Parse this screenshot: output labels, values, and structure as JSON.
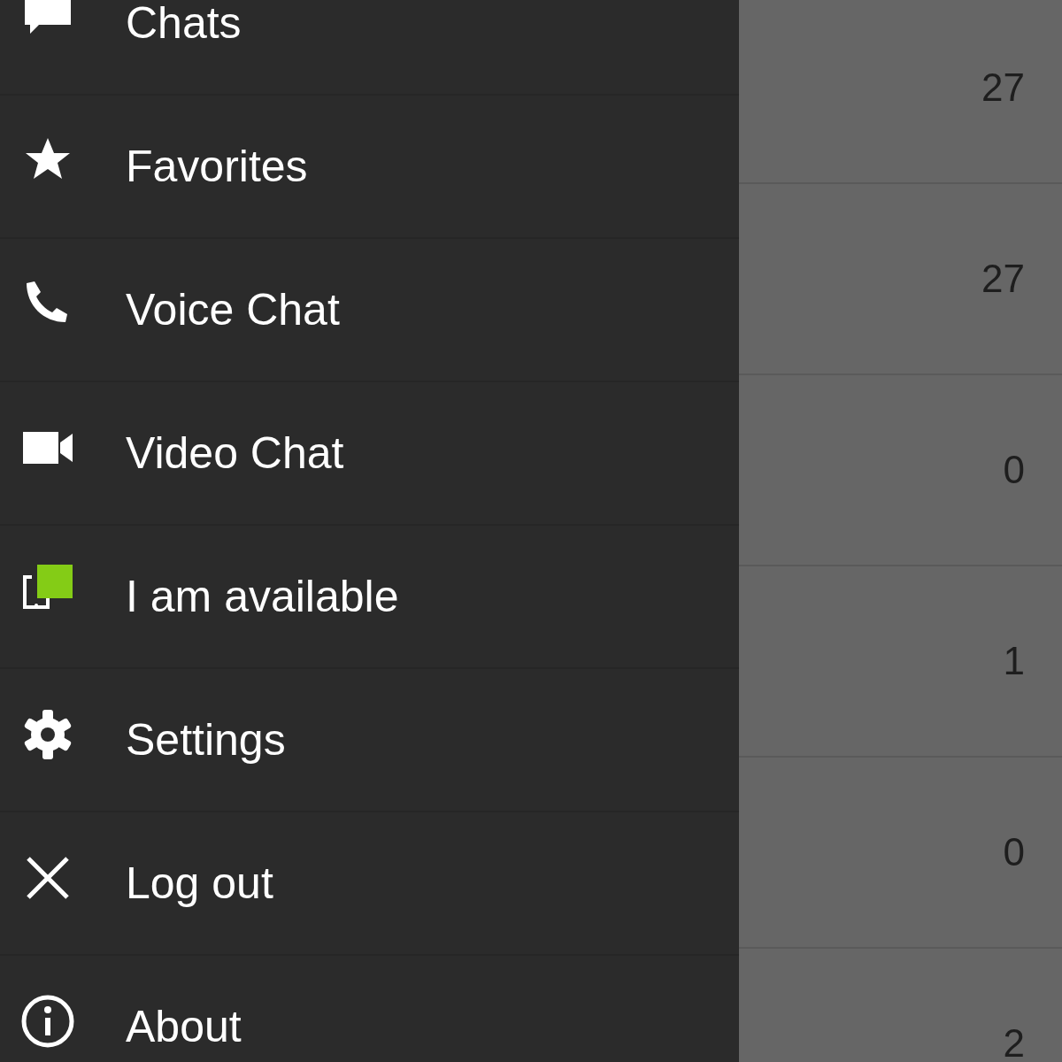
{
  "drawer": {
    "items": [
      {
        "label": "Chats"
      },
      {
        "label": "Favorites"
      },
      {
        "label": "Voice Chat"
      },
      {
        "label": "Video Chat"
      },
      {
        "label": "I am available"
      },
      {
        "label": "Settings"
      },
      {
        "label": "Log out"
      },
      {
        "label": "About"
      }
    ]
  },
  "list": {
    "counts": [
      "27",
      "27",
      "0",
      "1",
      "0",
      "2"
    ]
  }
}
